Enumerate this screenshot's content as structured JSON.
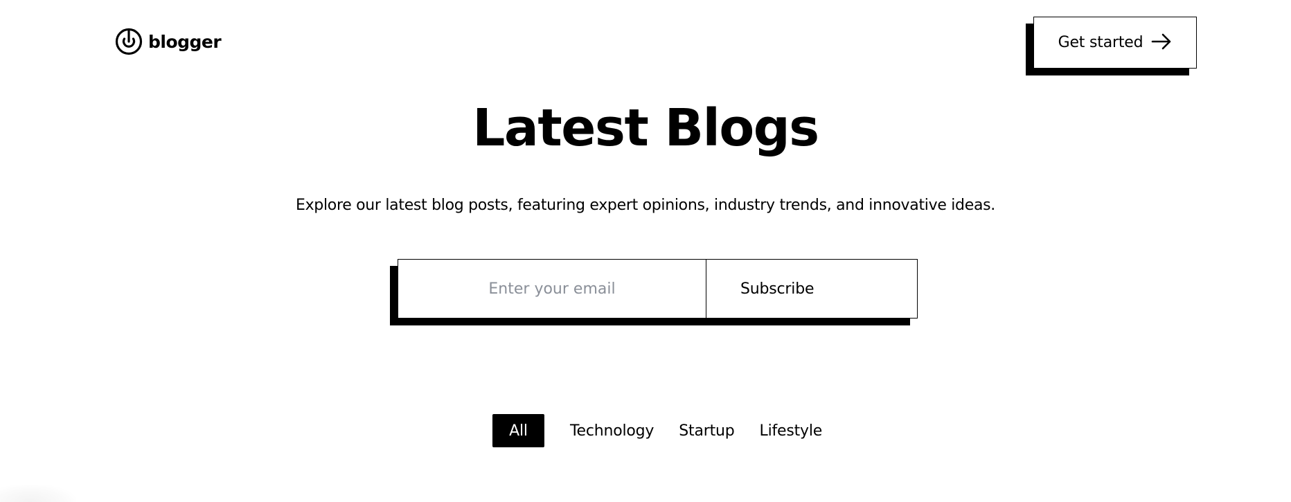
{
  "header": {
    "logo_icon": "blogger-logo-icon",
    "logo_text": "blogger",
    "cta_label": "Get started",
    "cta_icon": "arrow-right-icon"
  },
  "hero": {
    "title": "Latest Blogs",
    "subtitle": "Explore our latest blog posts, featuring expert opinions, industry trends, and innovative ideas."
  },
  "subscribe": {
    "email_placeholder": "Enter your email",
    "email_value": "",
    "button_label": "Subscribe"
  },
  "filters": {
    "tabs": [
      {
        "label": "All",
        "active": true
      },
      {
        "label": "Technology",
        "active": false
      },
      {
        "label": "Startup",
        "active": false
      },
      {
        "label": "Lifestyle",
        "active": false
      }
    ]
  },
  "colors": {
    "text": "#000000",
    "background": "#ffffff",
    "placeholder": "#8a8f98",
    "active_tab_bg": "#000000",
    "active_tab_text": "#ffffff"
  }
}
